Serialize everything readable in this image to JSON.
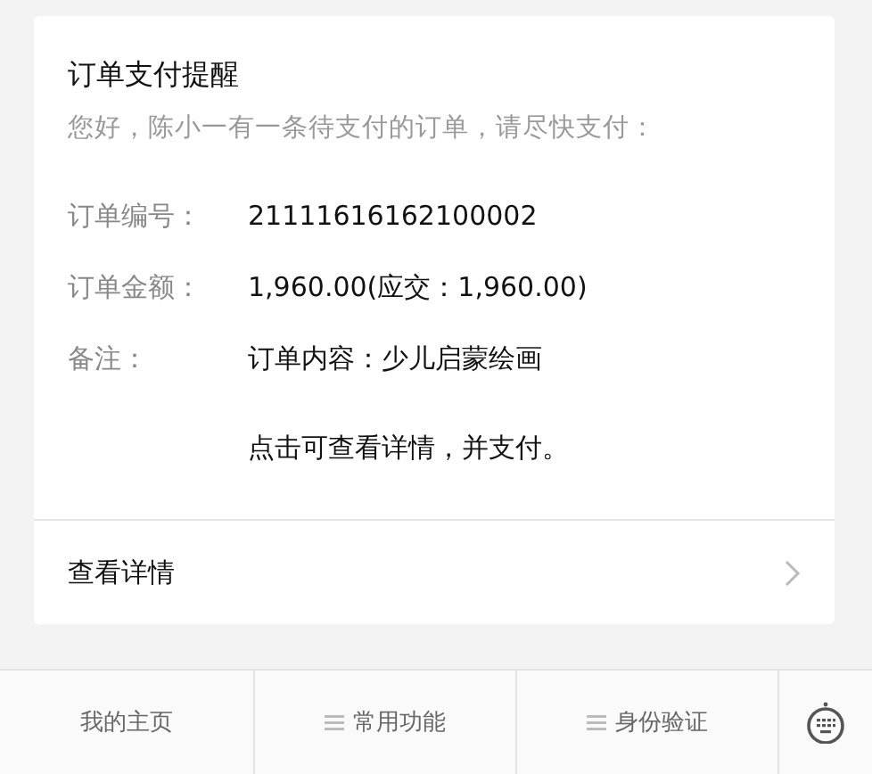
{
  "card": {
    "title": "订单支付提醒",
    "greeting": "您好，陈小一有一条待支付的订单，请尽快支付：",
    "fields": [
      {
        "label": "订单编号：",
        "value": "21111616162100002"
      },
      {
        "label": "订单金额：",
        "value": "1,960.00(应交：1,960.00)"
      },
      {
        "label": "备注：",
        "value": "订单内容：少儿启蒙绘画"
      }
    ],
    "note": "点击可查看详情，并支付。",
    "link": "查看详情"
  },
  "bottom_menu": [
    {
      "label": "我的主页",
      "has_submenu": false
    },
    {
      "label": "常用功能",
      "has_submenu": true
    },
    {
      "label": "身份验证",
      "has_submenu": true
    }
  ]
}
